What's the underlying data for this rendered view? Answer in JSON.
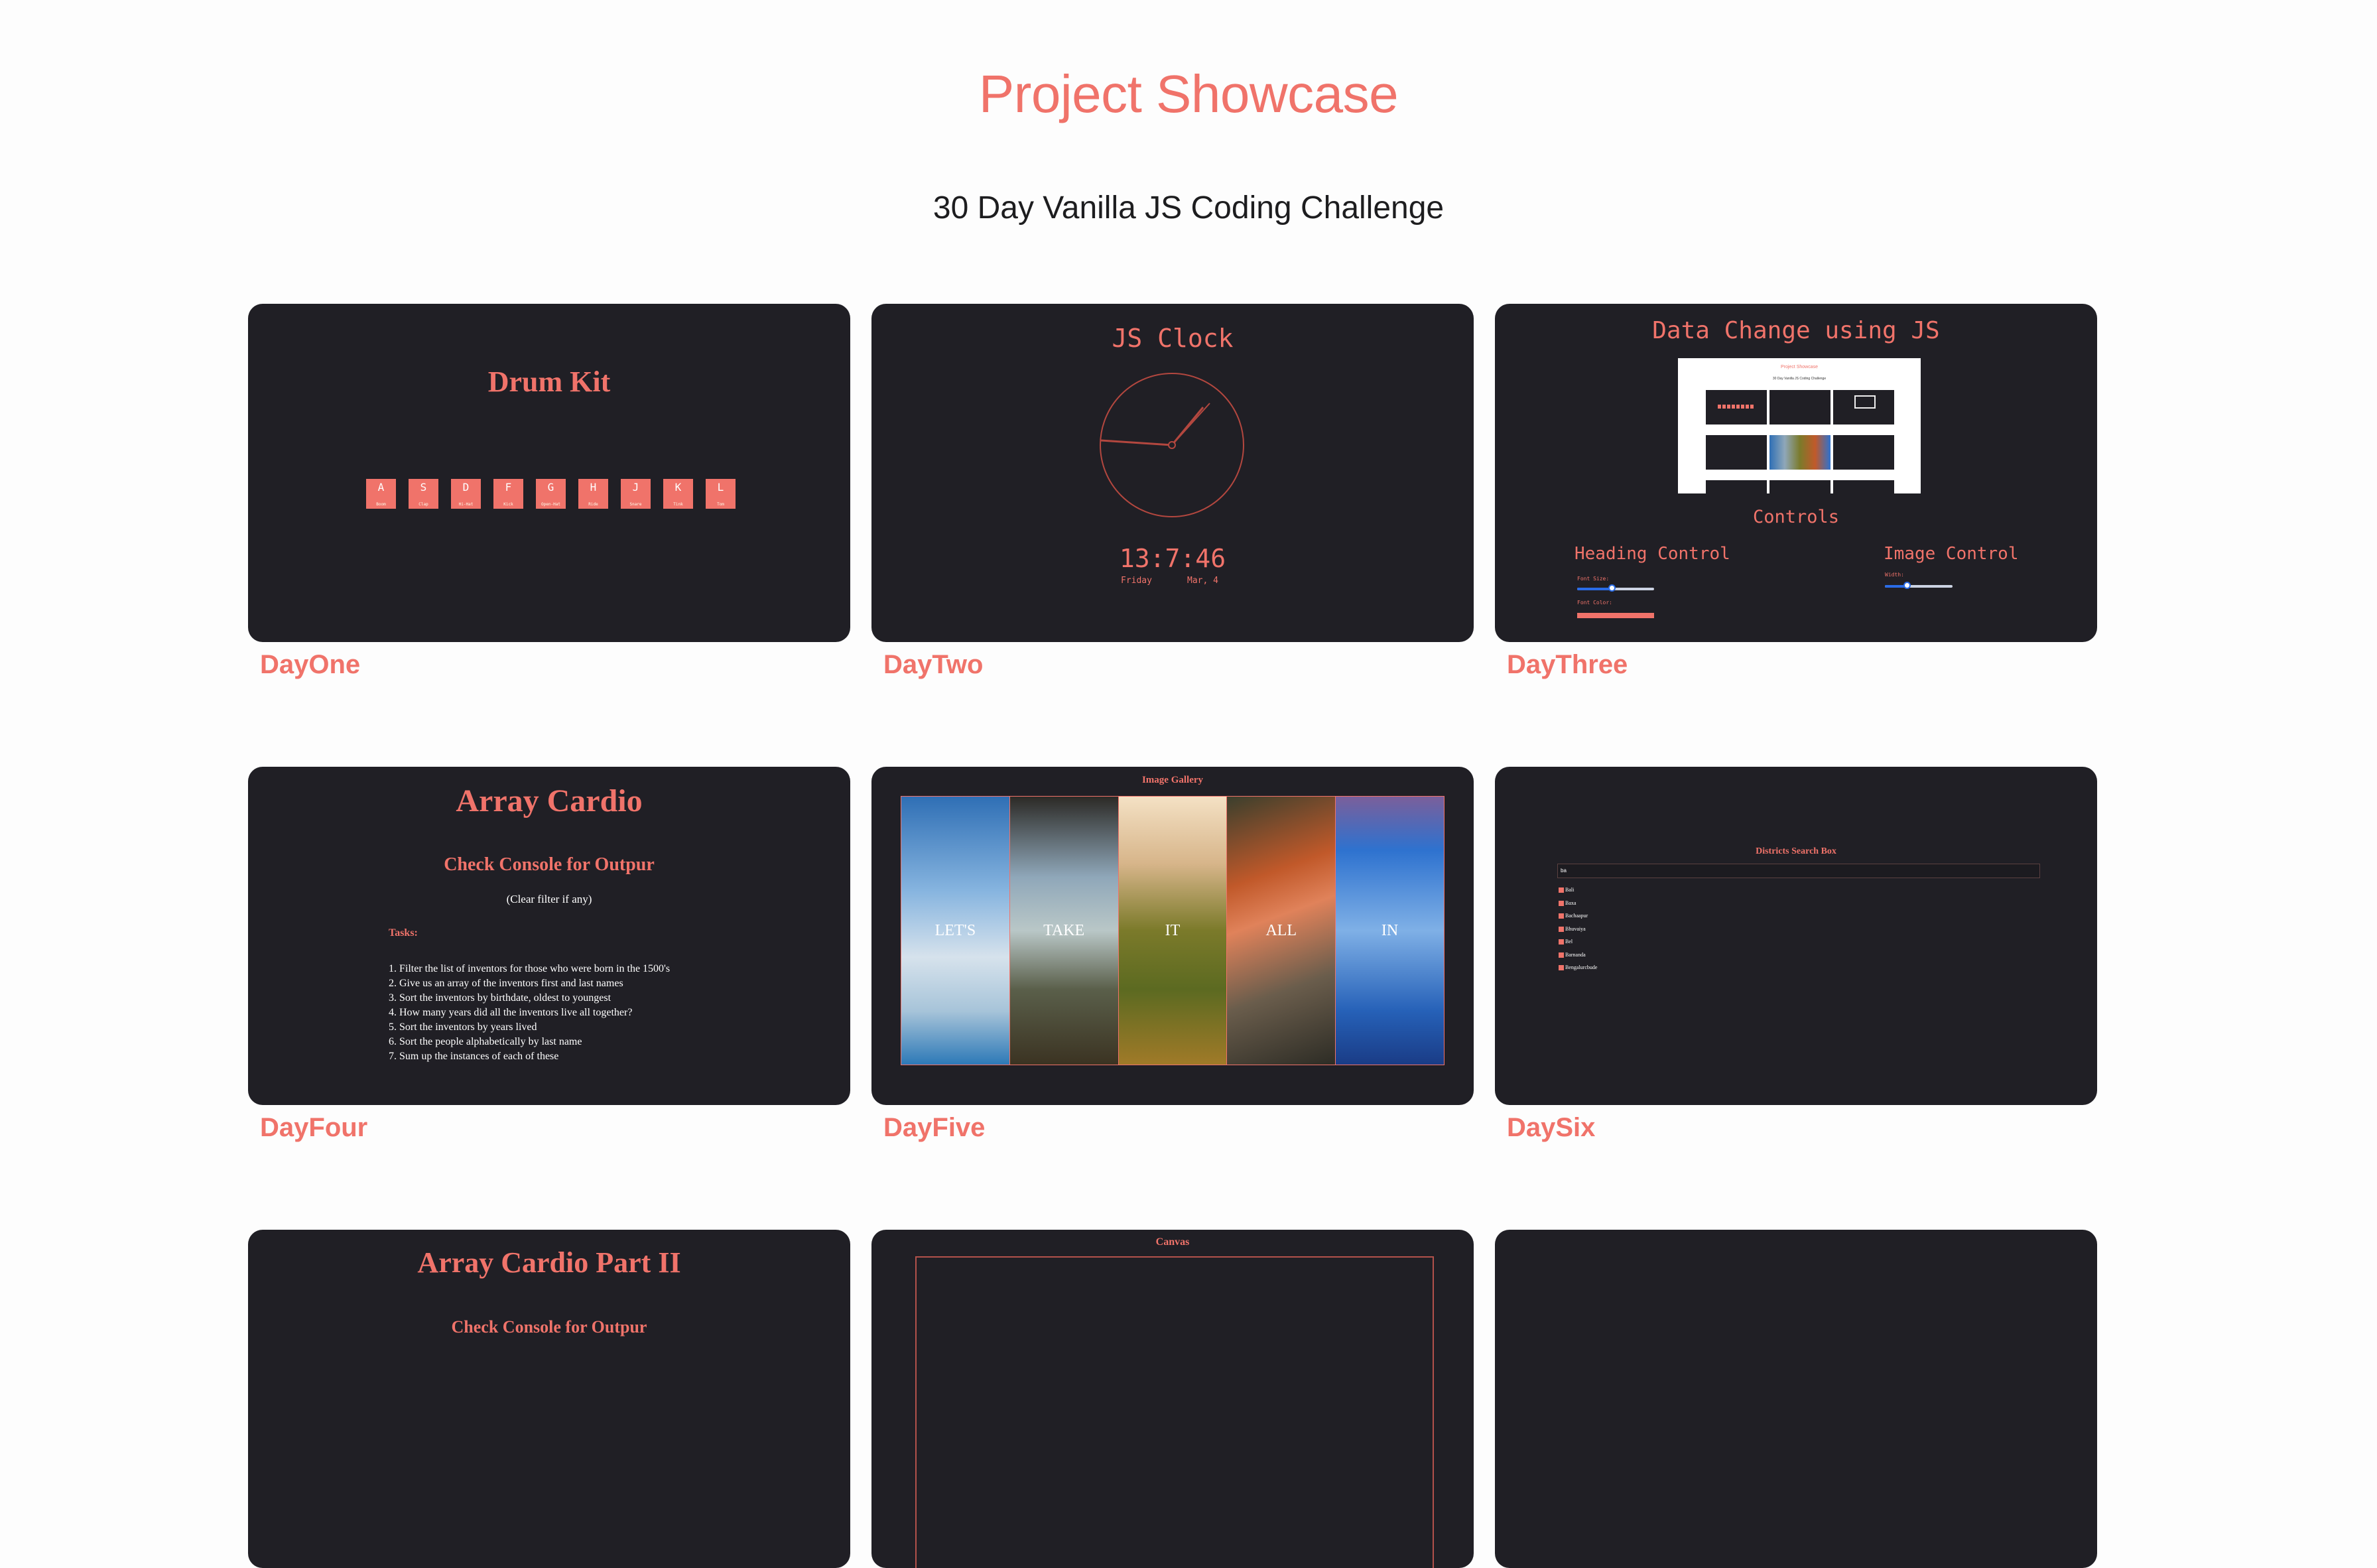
{
  "header": {
    "title": "Project Showcase",
    "subtitle": "30 Day Vanilla JS Coding Challenge"
  },
  "cards": {
    "day_one": {
      "label": "DayOne",
      "title": "Drum Kit",
      "keys": [
        {
          "key": "A",
          "sound": "Boom"
        },
        {
          "key": "S",
          "sound": "Clap"
        },
        {
          "key": "D",
          "sound": "Hi-Hat"
        },
        {
          "key": "F",
          "sound": "Kick"
        },
        {
          "key": "G",
          "sound": "Open-Hat"
        },
        {
          "key": "H",
          "sound": "Ride"
        },
        {
          "key": "J",
          "sound": "Snare"
        },
        {
          "key": "K",
          "sound": "Tink"
        },
        {
          "key": "L",
          "sound": "Tom"
        }
      ]
    },
    "day_two": {
      "label": "DayTwo",
      "title": "JS Clock",
      "time": "13:7:46",
      "day": "Friday",
      "date": "Mar, 4"
    },
    "day_three": {
      "label": "DayThree",
      "title": "Data Change using JS",
      "controls_label": "Controls",
      "heading_control": "Heading Control",
      "image_control": "Image Control",
      "font_size_label": "Font Size:",
      "font_color_label": "Font Color:",
      "width_label": "Width:",
      "preview_title": "Project Showcase",
      "preview_subtitle": "30 Day Vanilla JS Coding Challenge",
      "font_size_slider": 0.45,
      "width_slider": 0.32
    },
    "day_four": {
      "label": "DayFour",
      "title": "Array Cardio",
      "check": "Check Console for Outpur",
      "clear": "(Clear filter if any)",
      "tasks_label": "Tasks:",
      "tasks": [
        "1. Filter the list of inventors for those who were born in the 1500's",
        "2. Give us an array of the inventors first and last names",
        "3. Sort the inventors by birthdate, oldest to youngest",
        "4. How many years did all the inventors live all together?",
        "5. Sort the inventors by years lived",
        "6. Sort the people alphabetically by last name",
        "7. Sum up the instances of each of these"
      ]
    },
    "day_five": {
      "label": "DayFive",
      "title": "Image Gallery",
      "panels": [
        "LET'S",
        "TAKE",
        "IT",
        "ALL",
        "IN"
      ]
    },
    "day_six": {
      "label": "DaySix",
      "title": "Districts Search Box",
      "input_value": "ba",
      "results": [
        "Bali",
        "Baxa",
        "Bachaapur",
        "Bhuvaiya",
        "Bel",
        "Barnanda",
        "Bengalurcbude"
      ]
    },
    "day_seven": {
      "title": "Array Cardio Part II",
      "check": "Check Console for Outpur"
    },
    "day_eight": {
      "title": "Canvas"
    }
  },
  "colors": {
    "accent": "#f0736a",
    "card_bg": "#201f25",
    "page_bg": "#fdfdfd"
  }
}
